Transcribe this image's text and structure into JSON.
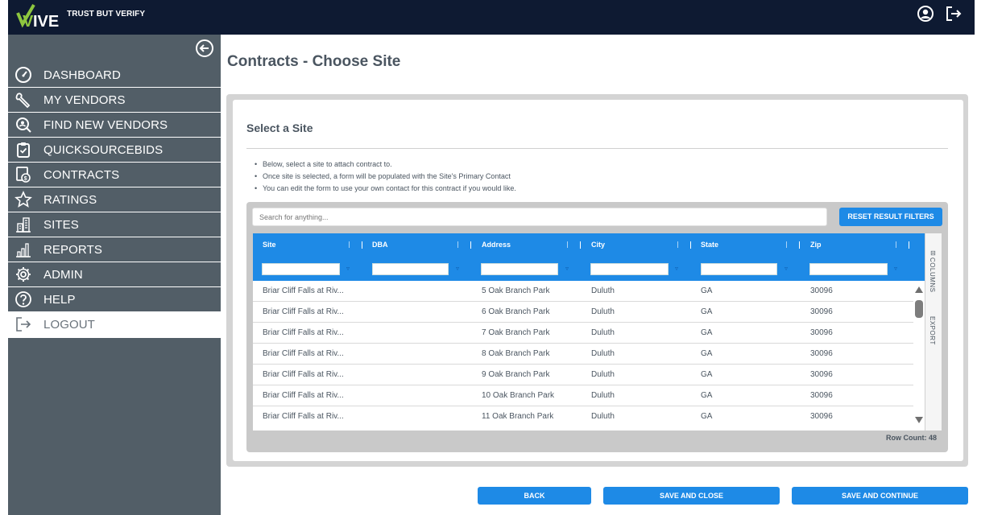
{
  "brand": {
    "logo_text": "VIVE",
    "tagline": "TRUST BUT VERIFY"
  },
  "topbar": {
    "icons": [
      "account-icon",
      "logout-icon"
    ]
  },
  "sidebar": {
    "items": [
      {
        "label": "DASHBOARD",
        "icon": "speedometer-icon"
      },
      {
        "label": "MY VENDORS",
        "icon": "wrench-icon"
      },
      {
        "label": "FIND NEW VENDORS",
        "icon": "search-person-icon"
      },
      {
        "label": "QUICKSOURCEBIDS",
        "icon": "clipboard-icon"
      },
      {
        "label": "CONTRACTS",
        "icon": "contract-dollar-icon"
      },
      {
        "label": "RATINGS",
        "icon": "star-icon"
      },
      {
        "label": "SITES",
        "icon": "building-icon"
      },
      {
        "label": "REPORTS",
        "icon": "bar-chart-icon"
      },
      {
        "label": "ADMIN",
        "icon": "gear-icon"
      },
      {
        "label": "HELP",
        "icon": "question-icon"
      },
      {
        "label": "LOGOUT",
        "icon": "logout-icon"
      }
    ]
  },
  "main": {
    "title": "Contracts - Choose Site",
    "section_title": "Select a Site",
    "instructions": [
      "Below, select a site to attach contract to.",
      "Once site is selected, a form will be populated with the Site's Primary Contact",
      "You can edit the form to use your own contact for this contract if you would like."
    ]
  },
  "grid": {
    "search_placeholder": "Search for anything...",
    "reset_label": "RESET RESULT FILTERS",
    "columns": [
      "Site",
      "DBA",
      "Address",
      "City",
      "State",
      "Zip"
    ],
    "rows": [
      [
        "Briar Cliff Falls at Riv...",
        "",
        "5 Oak Branch Park",
        "Duluth",
        "GA",
        "30096"
      ],
      [
        "Briar Cliff Falls at Riv...",
        "",
        "6 Oak Branch Park",
        "Duluth",
        "GA",
        "30096"
      ],
      [
        "Briar Cliff Falls at Riv...",
        "",
        "7 Oak Branch Park",
        "Duluth",
        "GA",
        "30096"
      ],
      [
        "Briar Cliff Falls at Riv...",
        "",
        "8 Oak Branch Park",
        "Duluth",
        "GA",
        "30096"
      ],
      [
        "Briar Cliff Falls at Riv...",
        "",
        "9 Oak Branch Park",
        "Duluth",
        "GA",
        "30096"
      ],
      [
        "Briar Cliff Falls at Riv...",
        "",
        "10 Oak Branch Park",
        "Duluth",
        "GA",
        "30096"
      ],
      [
        "Briar Cliff Falls at Riv...",
        "",
        "11 Oak Branch Park",
        "Duluth",
        "GA",
        "30096"
      ]
    ],
    "side_tabs": [
      "COLUMNS",
      "EXPORT"
    ],
    "row_count": "Row Count: 48"
  },
  "footer": {
    "back": "BACK",
    "save_close": "SAVE AND CLOSE",
    "save_continue": "SAVE AND CONTINUE"
  },
  "colors": {
    "navy": "#0e1a32",
    "sidebar": "#525e67",
    "accent": "#1e8ae6",
    "brand_green": "#8dc63f"
  }
}
